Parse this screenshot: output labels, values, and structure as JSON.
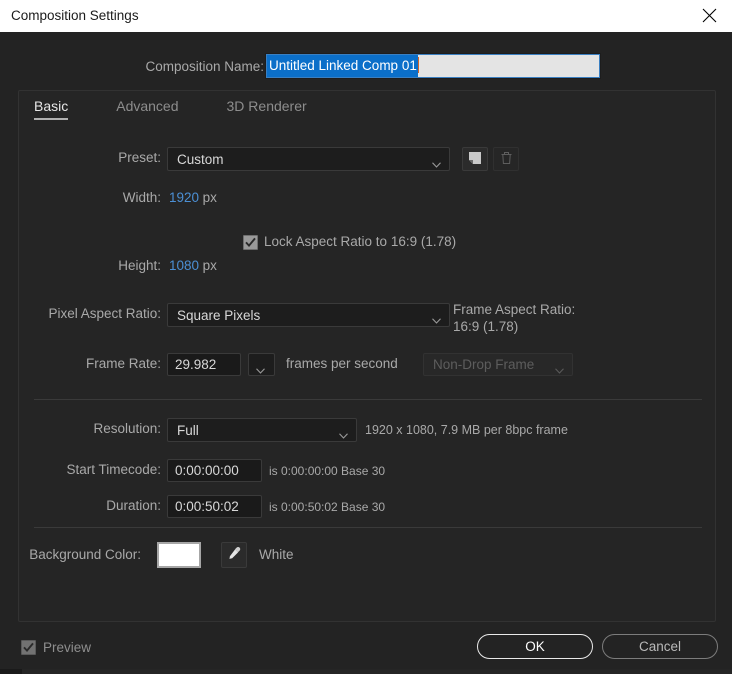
{
  "window": {
    "title": "Composition Settings",
    "close_icon": "close-icon"
  },
  "composition_name": {
    "label": "Composition Name:",
    "value": "Untitled Linked Comp 01",
    "selected": true
  },
  "tabs": [
    {
      "id": "basic",
      "label": "Basic",
      "active": true
    },
    {
      "id": "advanced",
      "label": "Advanced",
      "active": false
    },
    {
      "id": "3drenderer",
      "label": "3D Renderer",
      "active": false
    }
  ],
  "preset": {
    "label": "Preset:",
    "value": "Custom",
    "new_icon": "new-preset-icon",
    "delete_icon": "trash-icon",
    "delete_disabled": true
  },
  "width": {
    "label": "Width:",
    "value": "1920",
    "unit": "px"
  },
  "height": {
    "label": "Height:",
    "value": "1080",
    "unit": "px"
  },
  "lock_aspect": {
    "label": "Lock Aspect Ratio to 16:9 (1.78)",
    "checked": true
  },
  "pixel_aspect_ratio": {
    "label": "Pixel Aspect Ratio:",
    "value": "Square Pixels"
  },
  "frame_aspect_ratio": {
    "label": "Frame Aspect Ratio:",
    "value": "16:9 (1.78)"
  },
  "frame_rate": {
    "label": "Frame Rate:",
    "value": "29.982",
    "unit": "frames per second",
    "drop_frame": "Non-Drop Frame",
    "drop_frame_disabled": true
  },
  "resolution": {
    "label": "Resolution:",
    "value": "Full",
    "info": "1920 x 1080, 7.9 MB per 8bpc frame"
  },
  "start_timecode": {
    "label": "Start Timecode:",
    "value": "0:00:00:00",
    "info": "is 0:00:00:00  Base 30"
  },
  "duration": {
    "label": "Duration:",
    "value": "0:00:50:02",
    "info": "is 0:00:50:02  Base 30"
  },
  "background_color": {
    "label": "Background Color:",
    "swatch_hex": "#ffffff",
    "eyedropper_icon": "eyedropper-icon",
    "name": "White"
  },
  "footer": {
    "preview_label": "Preview",
    "preview_checked": true,
    "ok_label": "OK",
    "cancel_label": "Cancel"
  },
  "colors": {
    "accent_blue": "#4b8fd4",
    "selection_blue": "#0b6fc9",
    "dialog_bg": "#232323",
    "panel_bg": "#252525"
  }
}
